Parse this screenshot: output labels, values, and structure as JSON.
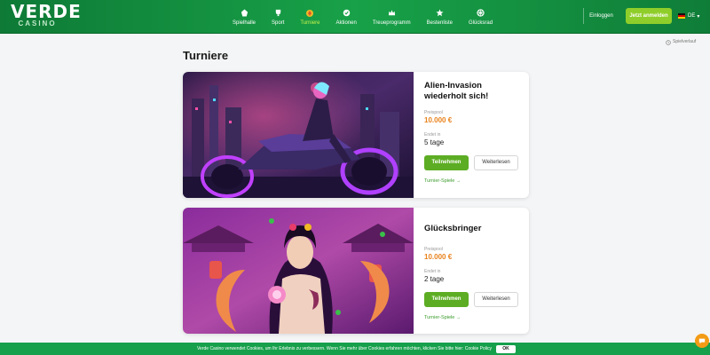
{
  "header": {
    "logo_top": "VERDE",
    "logo_bottom": "CASINO",
    "nav": [
      {
        "label": "Spielhalle",
        "icon": "slot-machine-icon"
      },
      {
        "label": "Sport",
        "icon": "trophy-icon"
      },
      {
        "label": "Turniere",
        "icon": "tournament-icon",
        "active": true
      },
      {
        "label": "Aktionen",
        "icon": "gift-icon"
      },
      {
        "label": "Treueprogramm",
        "icon": "crown-icon"
      },
      {
        "label": "Bestenliste",
        "icon": "star-icon"
      },
      {
        "label": "Glücksrad",
        "icon": "wheel-icon"
      }
    ],
    "login_label": "Einloggen",
    "register_label": "Jetzt anmelden",
    "lang_label": "DE",
    "colors": {
      "header_green": "#18a148",
      "register_lime": "#8fce2a",
      "active_nav": "#c9f24c"
    }
  },
  "subbar": {
    "game_history_label": "Spielverlauf"
  },
  "page": {
    "title": "Turniere"
  },
  "tournaments": [
    {
      "title": "Alien-Invasion wiederholt sich!",
      "prize_label": "Preispool",
      "prize_value": "10.000 €",
      "ends_label": "Endet in",
      "ends_value": "5 tage",
      "join_label": "Teilnehmen",
      "more_label": "Weiterlesen",
      "games_link": "Turnier-Spiele →"
    },
    {
      "title": "Glücksbringer",
      "prize_label": "Preispool",
      "prize_value": "10.000 €",
      "ends_label": "Endet in",
      "ends_value": "2 tage",
      "join_label": "Teilnehmen",
      "more_label": "Weiterlesen",
      "games_link": "Turnier-Spiele →"
    }
  ],
  "cookie": {
    "text": "Verde Casino verwendet Cookies, um Ihr Erlebnis zu verbessern. Wenn Sie mehr über Cookies erfahren möchten, klicken Sie bitte hier: Cookie Policy",
    "ok_label": "OK"
  },
  "accent_colors": {
    "prize": "#e8811a",
    "button_green": "#5cad23",
    "cookie_green": "#16a04b",
    "chat": "#f39b16"
  }
}
